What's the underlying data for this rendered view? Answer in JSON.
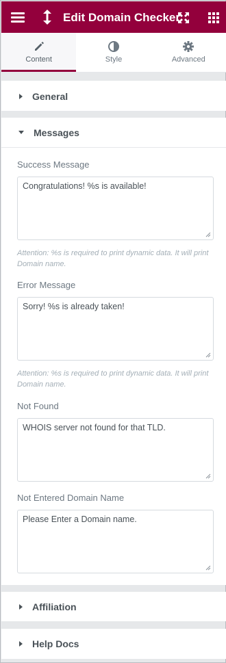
{
  "header": {
    "title": "Edit Domain Checker"
  },
  "tabs": [
    {
      "label": "Content",
      "icon": "pencil-icon"
    },
    {
      "label": "Style",
      "icon": "contrast-icon"
    },
    {
      "label": "Advanced",
      "icon": "gear-icon"
    }
  ],
  "sections": {
    "general": {
      "title": "General"
    },
    "messages": {
      "title": "Messages",
      "fields": [
        {
          "label": "Success Message",
          "value": "Congratulations! %s is available!",
          "note": "Attention: %s is required to print dynamic data. It will print Domain name."
        },
        {
          "label": "Error Message",
          "value": "Sorry! %s is already taken!",
          "note": "Attention: %s is required to print dynamic data. It will print Domain name."
        },
        {
          "label": "Not Found",
          "value": "WHOIS server not found for that TLD."
        },
        {
          "label": "Not Entered Domain Name",
          "value": "Please Enter a Domain name."
        }
      ]
    },
    "affiliation": {
      "title": "Affiliation"
    },
    "help_docs": {
      "title": "Help Docs"
    }
  },
  "colors": {
    "header_bg": "#93003c",
    "panel_bg": "#e6e8ea",
    "text": "#495157",
    "note": "#a4afb7"
  }
}
